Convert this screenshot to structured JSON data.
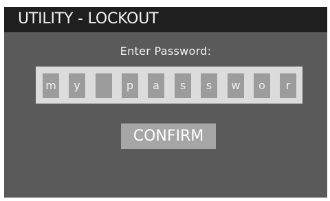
{
  "title": "UTILITY - LOCKOUT",
  "prompt": "Enter Password:",
  "password_chars": [
    "m",
    "y",
    "",
    "p",
    "a",
    "s",
    "s",
    "w",
    "o",
    "r"
  ],
  "confirm_label": "CONFIRM"
}
